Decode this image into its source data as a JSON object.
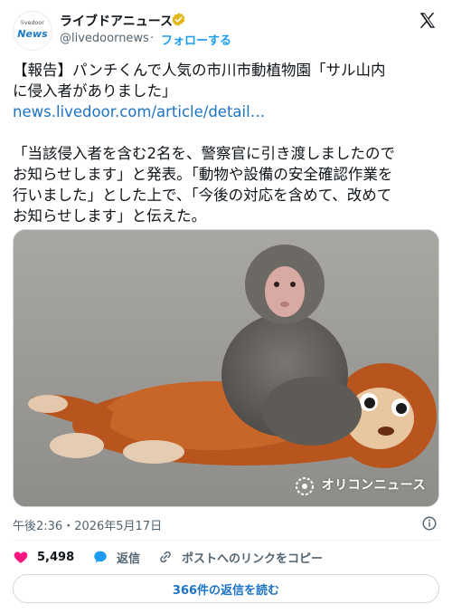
{
  "account": {
    "avatar_small_text": "livedoor",
    "avatar_big_text": "News",
    "name": "ライブドアニュース",
    "handle": "@livedoornews",
    "separator": "·",
    "follow_label": "フォローする",
    "verified_color": "#e2b719"
  },
  "tweet": {
    "line1": "【報告】パンチくんで人気の市川市動植物園「サル山内",
    "line2": "に侵入者がありました」",
    "link": "news.livedoor.com/article/detail…",
    "line3": "「当該侵入者を含む2名を、警察官に引き渡しましたので",
    "line4": "お知らせします」と発表。「動物や設備の安全確認作業を",
    "line5": "行いました」とした上で、「今後の対応を含めて、改めて",
    "line6": "お知らせします」と伝えた。"
  },
  "media": {
    "watermark": "オリコンニュース"
  },
  "meta": {
    "timestamp": "午後2:36・2026年5月17日"
  },
  "actions": {
    "like_count": "5,498",
    "reply_label": "返信",
    "copy_link_label": "ポストへのリンクをコピー"
  },
  "read_replies_label": "366件の返信を読む",
  "colors": {
    "accent": "#1d9bf0",
    "link": "#1d73c4",
    "like": "#f91880",
    "reply": "#1d9bf0"
  }
}
